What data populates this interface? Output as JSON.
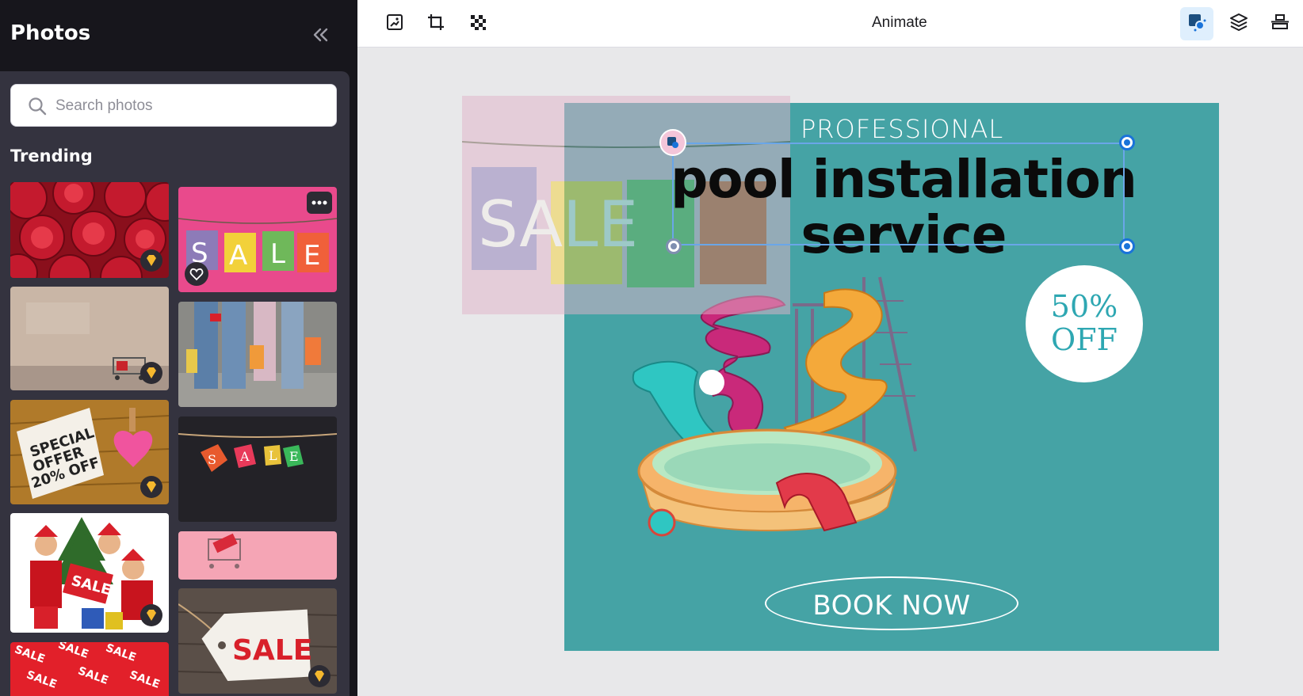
{
  "sidebar": {
    "title": "Photos",
    "search_placeholder": "Search photos",
    "section_title": "Trending",
    "photos": [
      {
        "name": "pomegranates-photo",
        "premium": true
      },
      {
        "name": "sale-bags-pink-photo",
        "premium": false
      },
      {
        "name": "shopping-cart-wall-photo",
        "premium": true
      },
      {
        "name": "shoppers-legs-photo",
        "premium": false
      },
      {
        "name": "special-offer-note-photo",
        "premium": true,
        "text": "SPECIAL OFFER 20% OFF"
      },
      {
        "name": "sale-tags-dark-photo",
        "premium": false
      },
      {
        "name": "santa-girls-sale-photo",
        "premium": true,
        "text": "SALE"
      },
      {
        "name": "pink-cart-black-friday-photo",
        "premium": false
      },
      {
        "name": "sale-pattern-photo",
        "premium": false
      },
      {
        "name": "sale-tag-wood-photo",
        "premium": true,
        "text": "SALE"
      }
    ]
  },
  "toolbar": {
    "animate_label": "Animate",
    "tools_left": [
      "replace-image-icon",
      "crop-icon",
      "transparency-icon"
    ],
    "tools_right": [
      "animate-element-icon",
      "layers-icon",
      "align-icon"
    ]
  },
  "design": {
    "background": "#45a3a5",
    "ghost_text": "SALE",
    "professional": "PROFESSIONAL",
    "headline_line1": "pool installation",
    "headline_line2": "service",
    "badge_line1": "50%",
    "badge_line2": "OFF",
    "cta": "BOOK NOW"
  },
  "colors": {
    "sidebar_bg": "#17161c",
    "panel_bg": "#34333f",
    "accent": "#1a73d9",
    "canvas_teal": "#45a3a5",
    "badge_text": "#2ea7b2"
  }
}
